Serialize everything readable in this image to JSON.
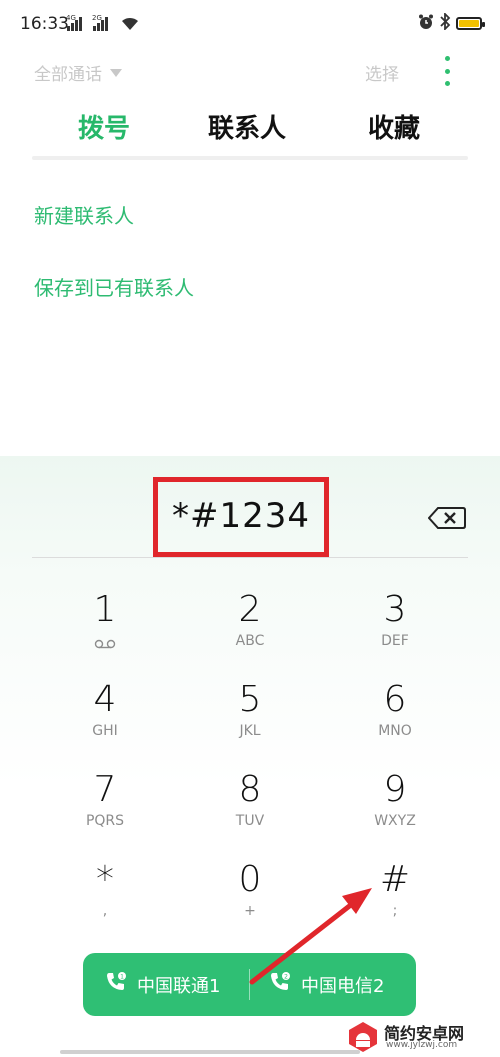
{
  "status_bar": {
    "time": "16:33",
    "sim1_network": "4G",
    "sim2_network": "2G",
    "battery_color": "#f2c100"
  },
  "top_bar": {
    "filter_label": "全部通话",
    "select_label": "选择"
  },
  "tabs": [
    {
      "label": "拨号",
      "active": true
    },
    {
      "label": "联系人",
      "active": false
    },
    {
      "label": "收藏",
      "active": false
    }
  ],
  "actions": {
    "new_contact": "新建联系人",
    "save_to_existing": "保存到已有联系人"
  },
  "dialer": {
    "number": "*#1234",
    "keys": [
      {
        "digit": "1",
        "letters": ""
      },
      {
        "digit": "2",
        "letters": "ABC"
      },
      {
        "digit": "3",
        "letters": "DEF"
      },
      {
        "digit": "4",
        "letters": "GHI"
      },
      {
        "digit": "5",
        "letters": "JKL"
      },
      {
        "digit": "6",
        "letters": "MNO"
      },
      {
        "digit": "7",
        "letters": "PQRS"
      },
      {
        "digit": "8",
        "letters": "TUV"
      },
      {
        "digit": "9",
        "letters": "WXYZ"
      },
      {
        "digit": "*",
        "letters": ","
      },
      {
        "digit": "0",
        "letters": "+"
      },
      {
        "digit": "#",
        "letters": ";"
      }
    ]
  },
  "call_buttons": {
    "sim1_label": "中国联通1",
    "sim2_label": "中国电信2",
    "sim1_badge": "1",
    "sim2_badge": "2"
  },
  "watermark": {
    "title": "简约安卓网",
    "url": "www.jylzwj.com"
  },
  "colors": {
    "accent": "#27b86a",
    "call_button": "#2fbf74",
    "highlight_box": "#e0262b",
    "annotation_arrow": "#e0262b"
  },
  "icons": [
    "signal-icon",
    "wifi-icon",
    "alarm-icon",
    "bluetooth-icon",
    "battery-icon",
    "more-icon",
    "backspace-icon",
    "voicemail-icon",
    "phone-sim-icon"
  ]
}
